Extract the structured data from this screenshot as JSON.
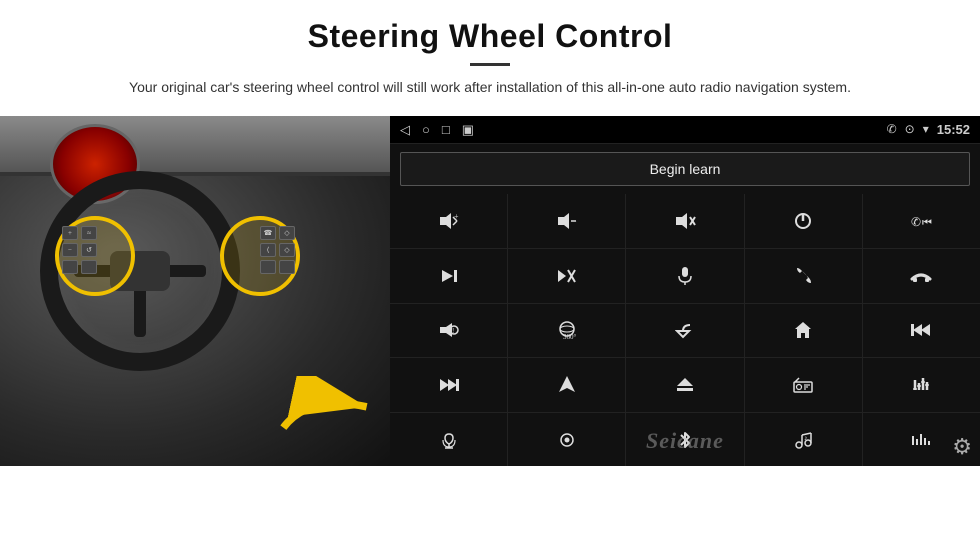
{
  "header": {
    "title": "Steering Wheel Control",
    "subtitle": "Your original car's steering wheel control will still work after installation of this all-in-one auto radio navigation system."
  },
  "radio_ui": {
    "status_bar": {
      "time": "15:52",
      "back_icon": "◁",
      "home_icon": "○",
      "recent_icon": "□",
      "signal_icon": "▣",
      "phone_icon": "✆",
      "location_icon": "⊙",
      "wifi_icon": "▾"
    },
    "begin_learn_label": "Begin learn",
    "control_buttons": [
      {
        "icon": "🔊+",
        "label": "vol-up"
      },
      {
        "icon": "🔊−",
        "label": "vol-down"
      },
      {
        "icon": "🔇",
        "label": "mute"
      },
      {
        "icon": "⏻",
        "label": "power"
      },
      {
        "icon": "⏮",
        "label": "prev-track-phone"
      },
      {
        "icon": "⏭",
        "label": "next"
      },
      {
        "icon": "⏭⃥",
        "label": "skip-mute"
      },
      {
        "icon": "🎤",
        "label": "mic"
      },
      {
        "icon": "📞",
        "label": "call"
      },
      {
        "icon": "📵",
        "label": "hang-up"
      },
      {
        "icon": "🔔",
        "label": "horn"
      },
      {
        "icon": "🎯",
        "label": "360"
      },
      {
        "icon": "↩",
        "label": "back"
      },
      {
        "icon": "🏠",
        "label": "home"
      },
      {
        "icon": "⏮⏮",
        "label": "rewind"
      },
      {
        "icon": "⏭",
        "label": "ff"
      },
      {
        "icon": "➤",
        "label": "navigate"
      },
      {
        "icon": "⏏",
        "label": "eject"
      },
      {
        "icon": "📻",
        "label": "radio"
      },
      {
        "icon": "⚙",
        "label": "eq"
      },
      {
        "icon": "🎙",
        "label": "voice"
      },
      {
        "icon": "⊕",
        "label": "settings2"
      },
      {
        "icon": "✱",
        "label": "bluetooth"
      },
      {
        "icon": "🎵",
        "label": "music-set"
      },
      {
        "icon": "📊",
        "label": "equalizer"
      }
    ],
    "seicane_watermark": "Seicane",
    "gear_label": "⚙"
  }
}
